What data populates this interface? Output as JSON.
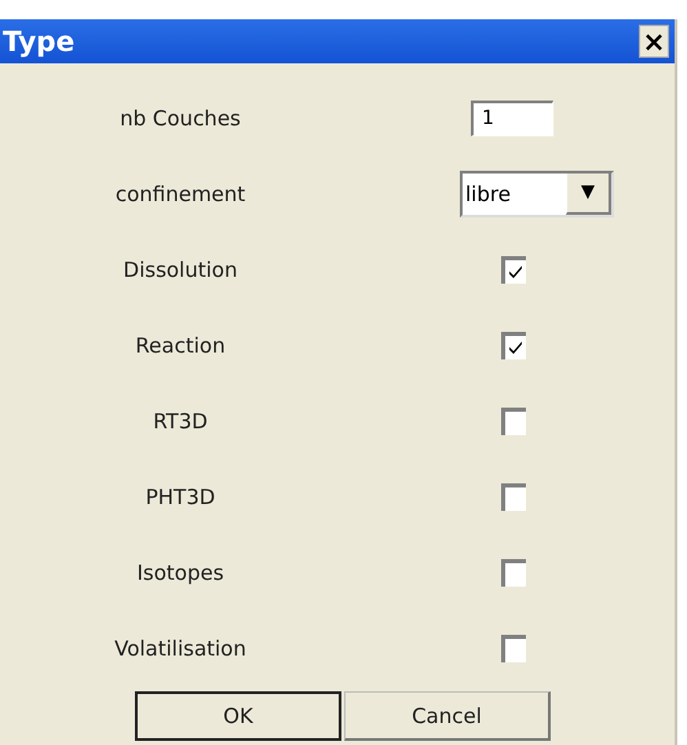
{
  "window": {
    "title": "Type",
    "close": "×"
  },
  "rows": [
    {
      "kind": "field",
      "label": "nb Couches",
      "value": "1"
    },
    {
      "kind": "dropdown",
      "label": "confinement",
      "value": "libre",
      "arrow": "▼"
    },
    {
      "kind": "checkbox",
      "label": "Dissolution",
      "checked": true
    },
    {
      "kind": "checkbox",
      "label": "Reaction",
      "checked": true
    },
    {
      "kind": "checkbox",
      "label": "RT3D",
      "checked": false
    },
    {
      "kind": "checkbox",
      "label": "PHT3D",
      "checked": false
    },
    {
      "kind": "checkbox",
      "label": "Isotopes",
      "checked": false
    },
    {
      "kind": "checkbox",
      "label": "Volatilisation",
      "checked": false
    }
  ],
  "buttons": [
    {
      "label": "OK",
      "default": true
    },
    {
      "label": "Cancel",
      "default": false
    }
  ]
}
